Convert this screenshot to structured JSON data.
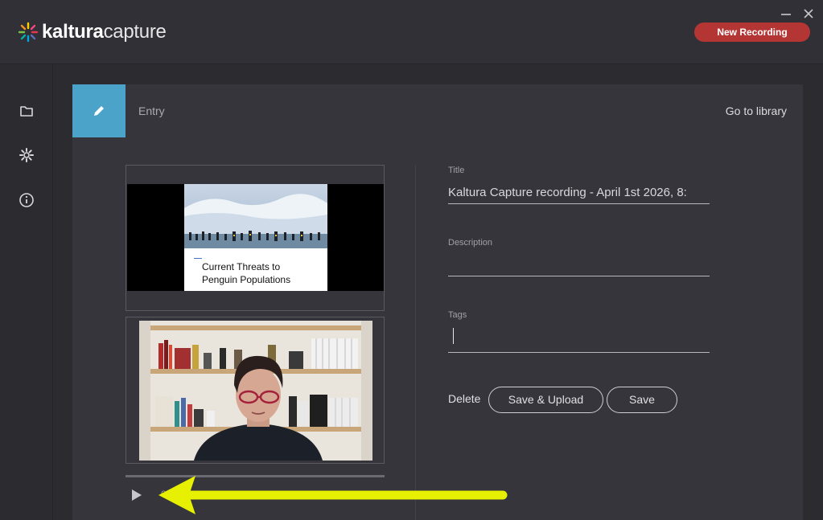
{
  "header": {
    "logo_bold": "kaltura",
    "logo_light": "capture",
    "new_recording_label": "New Recording",
    "minimize_icon": "minimize-icon",
    "close_icon": "close-icon"
  },
  "sidebar": {
    "items": [
      {
        "icon": "folder-icon"
      },
      {
        "icon": "gear-icon"
      },
      {
        "icon": "info-icon"
      }
    ]
  },
  "entry": {
    "section_label": "Entry",
    "go_to_library": "Go to library",
    "edit_icon": "pencil-icon"
  },
  "preview": {
    "slide_title_line1": "Current Threats to",
    "slide_title_line2": "Penguin Populations",
    "time_text": "0",
    "play_icon": "play-icon",
    "volume_icon": "volume-icon"
  },
  "form": {
    "title_label": "Title",
    "title_value": "Kaltura Capture recording - April 1st 2026, 8:",
    "description_label": "Description",
    "description_value": "",
    "tags_label": "Tags",
    "tags_value": "",
    "delete_label": "Delete",
    "save_upload_label": "Save & Upload",
    "save_label": "Save"
  },
  "colors": {
    "accent_blue": "#4ba3c9",
    "record_red": "#b43634",
    "annotation_yellow": "#e6f000"
  }
}
